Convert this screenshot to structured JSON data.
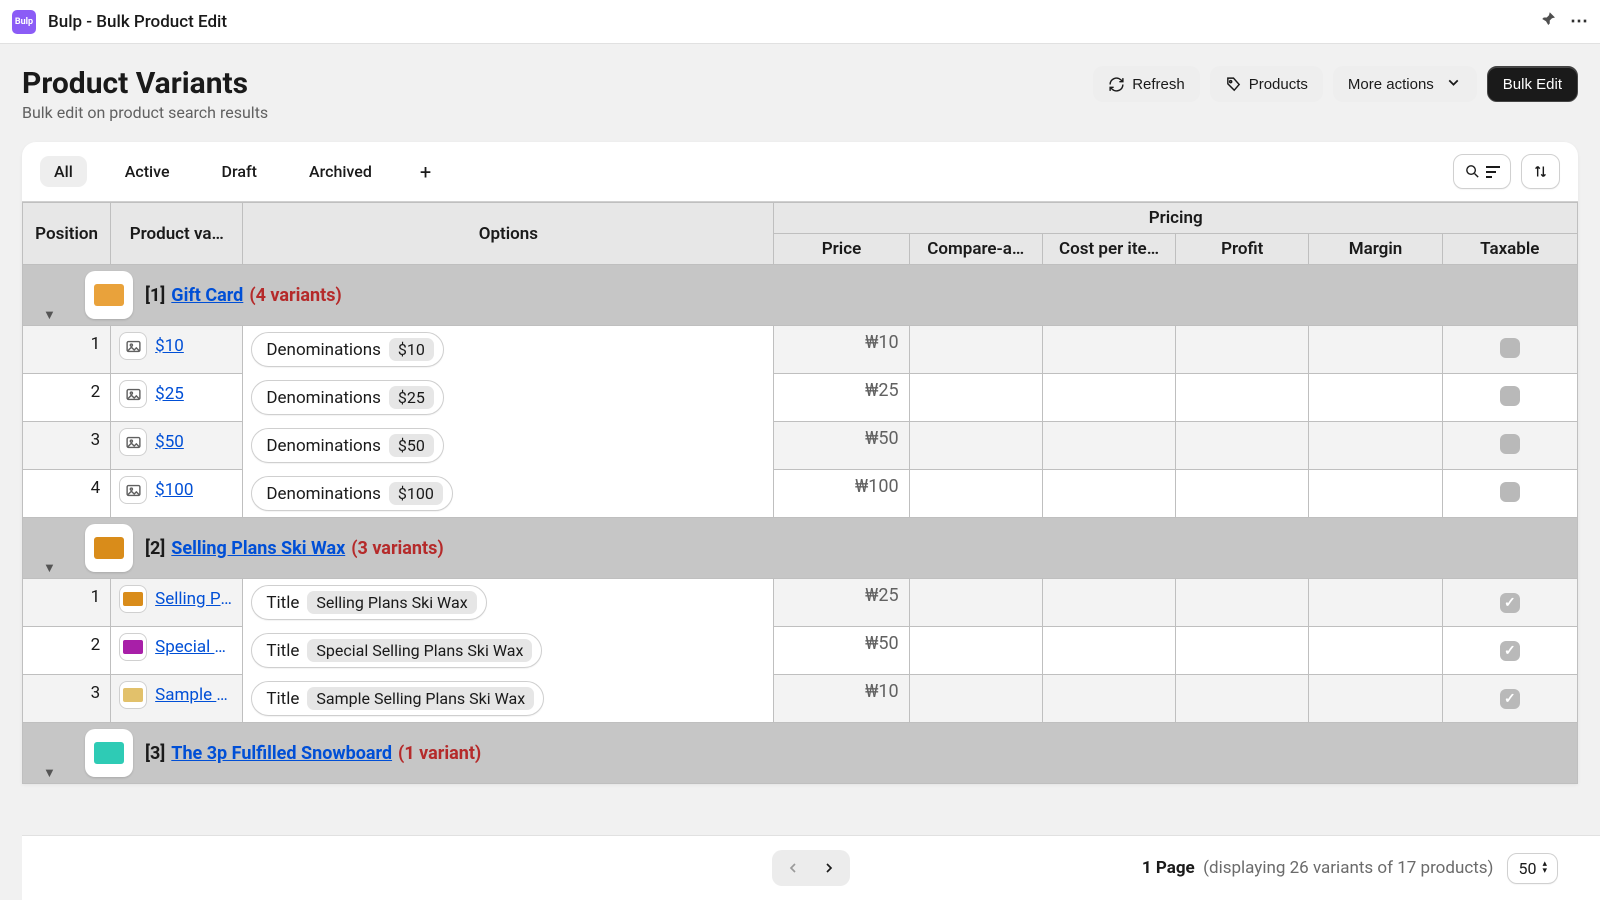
{
  "app": {
    "icon_label": "Bulp",
    "title": "Bulp - Bulk Product Edit"
  },
  "header": {
    "title": "Product Variants",
    "subtitle": "Bulk edit on product search results",
    "actions": {
      "refresh": "Refresh",
      "products": "Products",
      "more": "More actions",
      "bulk_edit": "Bulk Edit"
    }
  },
  "tabs": [
    "All",
    "Active",
    "Draft",
    "Archived"
  ],
  "active_tab": "All",
  "columns": {
    "position": "Position",
    "product_variant": "Product va…",
    "options": "Options",
    "pricing": "Pricing",
    "price": "Price",
    "compare": "Compare-a…",
    "cost": "Cost per ite…",
    "profit": "Profit",
    "margin": "Margin",
    "taxable": "Taxable"
  },
  "groups": [
    {
      "index": "[1]",
      "name": "Gift Card",
      "count": "(4 variants)",
      "thumb_color": "#e9a23b",
      "icon_mode": "svg",
      "variants": [
        {
          "pos": "1",
          "name": "$10",
          "option_key": "Denominations",
          "option_val": "$10",
          "price": "₩10",
          "taxable": false
        },
        {
          "pos": "2",
          "name": "$25",
          "option_key": "Denominations",
          "option_val": "$25",
          "price": "₩25",
          "taxable": false
        },
        {
          "pos": "3",
          "name": "$50",
          "option_key": "Denominations",
          "option_val": "$50",
          "price": "₩50",
          "taxable": false
        },
        {
          "pos": "4",
          "name": "$100",
          "option_key": "Denominations",
          "option_val": "$100",
          "price": "₩100",
          "taxable": false
        }
      ]
    },
    {
      "index": "[2]",
      "name": "Selling Plans Ski Wax",
      "count": "(3 variants)",
      "thumb_color": "#d98c1a",
      "icon_mode": "swatch",
      "variants": [
        {
          "pos": "1",
          "name": "Selling Plans Ski Wax",
          "swatch": "#d98c1a",
          "option_key": "Title",
          "option_val": "Selling Plans Ski Wax",
          "price": "₩25",
          "taxable": true
        },
        {
          "pos": "2",
          "name": "Special Selling Plans Ski Wax",
          "swatch": "#a81fa8",
          "option_key": "Title",
          "option_val": "Special Selling Plans Ski Wax",
          "price": "₩50",
          "taxable": true
        },
        {
          "pos": "3",
          "name": "Sample Selling Plans Ski Wax",
          "swatch": "#e2c16b",
          "option_key": "Title",
          "option_val": "Sample Selling Plans Ski Wax",
          "price": "₩10",
          "taxable": true
        }
      ]
    },
    {
      "index": "[3]",
      "name": "The 3p Fulfilled Snowboard",
      "count": "(1 variant)",
      "thumb_color": "#2ecbb5",
      "icon_mode": "swatch",
      "variants": []
    }
  ],
  "footer": {
    "page_label": "1 Page",
    "summary": "(displaying 26 variants of 17 products)",
    "page_size": "50"
  }
}
